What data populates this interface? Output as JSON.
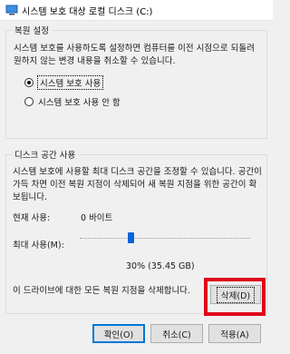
{
  "window": {
    "title": "시스템 보호 대상 로컬 디스크 (C:)",
    "icon": "system-protection-icon"
  },
  "restore_settings": {
    "legend": "복원 설정",
    "description": "시스템 보호를 사용하도록 설정하면 컴퓨터를 이전 시점으로 되돌려 원하지 않는 변경 내용을 취소할 수 있습니다.",
    "options": [
      {
        "label": "시스템 보호 사용",
        "selected": true
      },
      {
        "label": "시스템 보호 사용 안 함",
        "selected": false
      }
    ]
  },
  "disk_space": {
    "legend": "디스크 공간 사용",
    "description": "시스템 보호에 사용할 최대 디스크 공간을 조정할 수 있습니다. 공간이 가득 차면 이전 복원 지점이 삭제되어 새 복원 지점을 위한 공간이 확보됩니다.",
    "current_usage_label": "현재 사용:",
    "current_usage_value": "0 바이트",
    "max_usage_label": "최대 사용(M):",
    "max_usage_fraction": 0.3,
    "max_usage_value": "30% (35.45 GB)",
    "delete_text": "이 드라이브에 대한 모든 복원 지점을 삭제합니다.",
    "delete_button": "삭제(D)"
  },
  "buttons": {
    "ok": "확인(O)",
    "cancel": "취소(C)",
    "apply": "적용(A)"
  },
  "colors": {
    "accent": "#0078d7",
    "slider_thumb": "#0a64d6",
    "highlight": "#e0001a"
  }
}
